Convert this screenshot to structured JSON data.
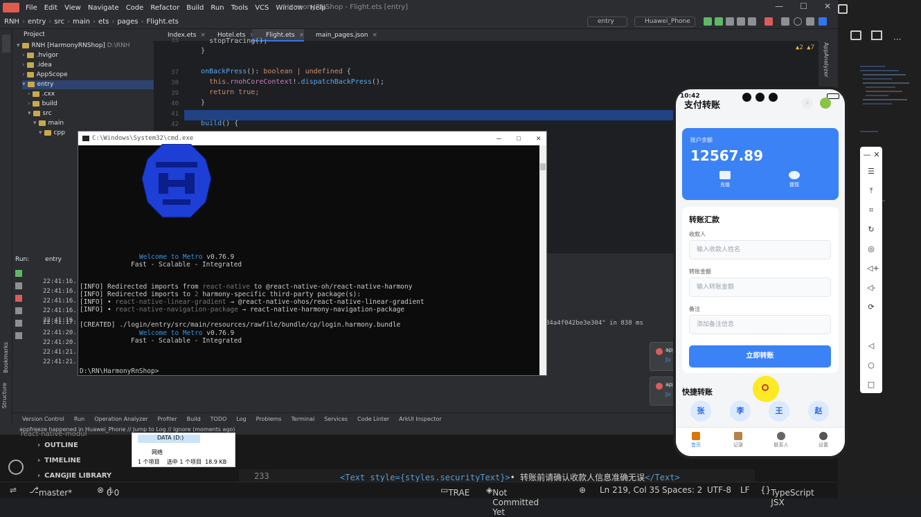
{
  "ide": {
    "menu": [
      "File",
      "Edit",
      "View",
      "Navigate",
      "Code",
      "Refactor",
      "Build",
      "Run",
      "Tools",
      "VCS",
      "Window",
      "Help"
    ],
    "title": "HarmonyRNShop - Flight.ets [entry]",
    "breadcrumb": [
      "RNH",
      "entry",
      "src",
      "main",
      "ets",
      "pages",
      "Flight.ets"
    ],
    "run_config": "entry",
    "device": "Huawei_Phone",
    "project_label": "Project",
    "tree": [
      {
        "label": "RNH [HarmonyRNShop]",
        "note": "D:\\RNH"
      },
      {
        "label": ".hvigor"
      },
      {
        "label": ".idea"
      },
      {
        "label": "AppScope"
      },
      {
        "label": "entry"
      },
      {
        "label": ".cxx"
      },
      {
        "label": "build"
      },
      {
        "label": "src"
      },
      {
        "label": "main"
      },
      {
        "label": "cpp"
      }
    ],
    "tabs": [
      "Index.ets",
      "Hotel.ets",
      "Flight.ets",
      "main_pages.json"
    ],
    "gutter": [
      "35",
      "36",
      "37",
      "38",
      "39",
      "40",
      "41",
      "42"
    ],
    "code": {
      "l0": "    stopTracing();",
      "l1": "  }",
      "l3a": "  onBackPress",
      "l3b": "(): ",
      "l3c": "boolean | undefined",
      "l3d": " {",
      "l4a": "    this.",
      "l4b": "rnohCoreContext",
      "l4c": "!.",
      "l4d": "dispatchBackPress",
      "l4e": "();",
      "l5a": "    return ",
      "l5b": "true;",
      "l6": "  }",
      "l8a": "  build",
      "l8b": "() {"
    },
    "warnings": "▲2  ▲7",
    "run_label": "Run:",
    "run_tab": "entry",
    "log_times": [
      "22:41:16.",
      "22:41:16.",
      "22:41:16.",
      "22:41:16.",
      "22:41:16.",
      "22:41:17.",
      "22:41:20.",
      "22:41:20.",
      "22:41:21.",
      "22:41:21."
    ],
    "log_tail": "84a4f042be3e304\" in 838 ms",
    "toast_title": "app",
    "toast_link": "Ju",
    "bottom_tools": [
      "Version Control",
      "Run",
      "Operation Analyzer",
      "Profiler",
      "Build",
      "TODO",
      "Log",
      "Problems",
      "Terminal",
      "Services",
      "Code Linter",
      "ArkUI Inspector"
    ],
    "status": "appfreeze happened in Huawei_Phone // Jump to Log // Ignore (moments ago)",
    "side_right": "AppAnalyzer",
    "side_left": [
      "Bookmarks",
      "Structure"
    ]
  },
  "cmd": {
    "title": "C:\\Windows\\System32\\cmd.exe",
    "welcome": "Welcome to Metro",
    "version": " v0.76.9",
    "tagline": "Fast - Scalable - Integrated",
    "lines": [
      {
        "a": "[INFO] Redirected imports from ",
        "b": "react-native",
        "c": " to @react-native-oh/react-native-harmony"
      },
      {
        "a": "[INFO] Redirected imports to ",
        "b": "2",
        "c": " harmony-specific third-party package(s):"
      },
      {
        "a": "[INFO] • ",
        "b": "react-native-linear-gradient",
        "c": " → @react-native-ohos/react-native-linear-gradient"
      },
      {
        "a": "[INFO] • ",
        "b": "react-native-navigation-package",
        "c": " → react-native-harmony-navigation-package"
      }
    ],
    "created": "[CREATED] ./login/entry/src/main/resources/rawfile/bundle/cp/login.harmony.bundle",
    "prompt": "D:\\RN\\HarmonyRnShop>"
  },
  "vscode": {
    "outline": "OUTLINE",
    "timeline": "TIMELINE",
    "cangjie": "CANGJIE LIBRARY",
    "line_no": "233",
    "code_a": "<Text style={styles.securityText}>",
    "code_b": "• 转账前请确认收款人信息准确无误",
    "code_c": "</Text>",
    "partial": "react-native-modul",
    "status": {
      "branch": "master*",
      "errors": "0",
      "warnings": "0",
      "trae": "TRAE",
      "commit": "Not Committed Yet",
      "pos": "Ln 219, Col 35",
      "spaces": "Spaces: 2",
      "enc": "UTF-8",
      "eol": "LF",
      "lang": "TypeScript JSX"
    }
  },
  "explorer": {
    "drive": "DATA (D:)",
    "network": "网络",
    "count": "1 个项目",
    "selected": "选中 1 个项目",
    "size": "18.9 KB"
  },
  "phone": {
    "time": "10:42",
    "app_title": "支付转账",
    "balance_label": "账户余额",
    "balance": "12567.89",
    "recharge": "充值",
    "withdraw": "提现",
    "section_title": "转账汇款",
    "payee_label": "收款人",
    "payee_placeholder": "输入收款人姓名",
    "amount_label": "转账金额",
    "amount_placeholder": "输入转账金额",
    "note_label": "备注",
    "note_placeholder": "添加备注信息",
    "submit": "立即转账",
    "quick_title": "快捷转账",
    "contacts": [
      "张",
      "李",
      "王",
      "赵"
    ],
    "tabs": [
      "首页",
      "记录",
      "联系人",
      "设置"
    ]
  }
}
